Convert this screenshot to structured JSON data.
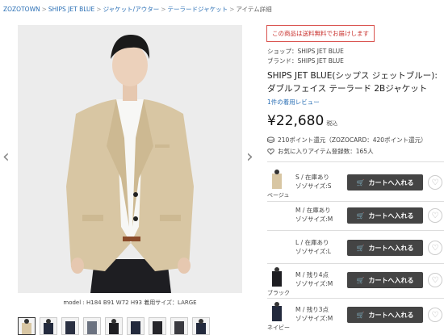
{
  "breadcrumb": {
    "items": [
      "ZOZOTOWN",
      "SHIPS JET BLUE",
      "ジャケット/アウター",
      "テーラードジャケット",
      "アイテム詳細"
    ],
    "separator": ">"
  },
  "photo": {
    "caption": "model : H184 B91 W72 H93 着用サイズ：LARGE",
    "prev_icon": "chevron-left-icon",
    "next_icon": "chevron-right-icon"
  },
  "thumbnails": [
    "beige",
    "navy-model",
    "navy",
    "gray",
    "black",
    "navy-2",
    "black-2",
    "dark",
    "navy-3"
  ],
  "product": {
    "notice": "この商品は送料無料でお届けします",
    "shop": "ショップ：SHIPS JET BLUE",
    "brand": "ブランド：SHIPS JET BLUE",
    "title": "SHIPS JET BLUE(シップス ジェットブルー): ダブルフェイス テーラード 2Bジャケット",
    "reviews": "1件の着用レビュー",
    "price": "¥22,680",
    "tax": "税込",
    "points": "210ポイント還元（ZOZOCARD：420ポイント還元）",
    "favorites": "お気に入りアイテム登録数：165人"
  },
  "cart_label": "カートへ入れる",
  "colors": {
    "beige": "#d8c6a3",
    "black": "#1e1e22",
    "navy": "#232a3d",
    "button": "#444444",
    "notice_red": "#c9302c"
  },
  "variants": [
    {
      "color": "ベージュ",
      "stock": "S / 在庫あり",
      "size": "ゾゾサイズ:S"
    },
    {
      "color": "",
      "stock": "M / 在庫あり",
      "size": "ゾゾサイズ:M"
    },
    {
      "color": "",
      "stock": "L / 在庫あり",
      "size": "ゾゾサイズ:L"
    },
    {
      "color": "ブラック",
      "stock": "M / 残り4点",
      "size": "ゾゾサイズ:M"
    },
    {
      "color": "ネイビー",
      "stock": "M / 残り3点",
      "size": "ゾゾサイズ:M"
    }
  ]
}
